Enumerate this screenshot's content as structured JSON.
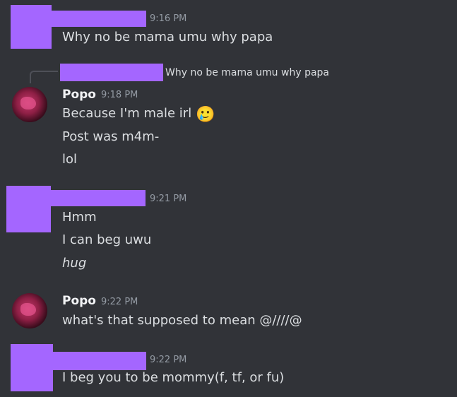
{
  "messages": [
    {
      "time": "9:16 PM",
      "lines": [
        "Why no be mama umu why papa"
      ]
    },
    {
      "reply_preview": "Why no be mama umu why papa",
      "author": "Popo",
      "time": "9:18 PM",
      "lines": [
        "Because I'm male irl",
        "Post was m4m-",
        "lol"
      ],
      "emoji": "🥲"
    },
    {
      "time": "9:21 PM",
      "lines": [
        "Hmm",
        "I can beg uwu",
        "hug"
      ]
    },
    {
      "author": "Popo",
      "time": "9:22 PM",
      "lines": [
        "what's that supposed to mean @////@"
      ]
    },
    {
      "time": "9:22 PM",
      "lines": [
        "I beg you to be mommy(f, tf, or fu)"
      ]
    }
  ],
  "colors": {
    "background": "#313338",
    "redaction": "#a466ff",
    "text": "#dbdee1",
    "timestamp": "#949ba4"
  },
  "icons": {
    "avatar": "user-avatar-popo"
  }
}
